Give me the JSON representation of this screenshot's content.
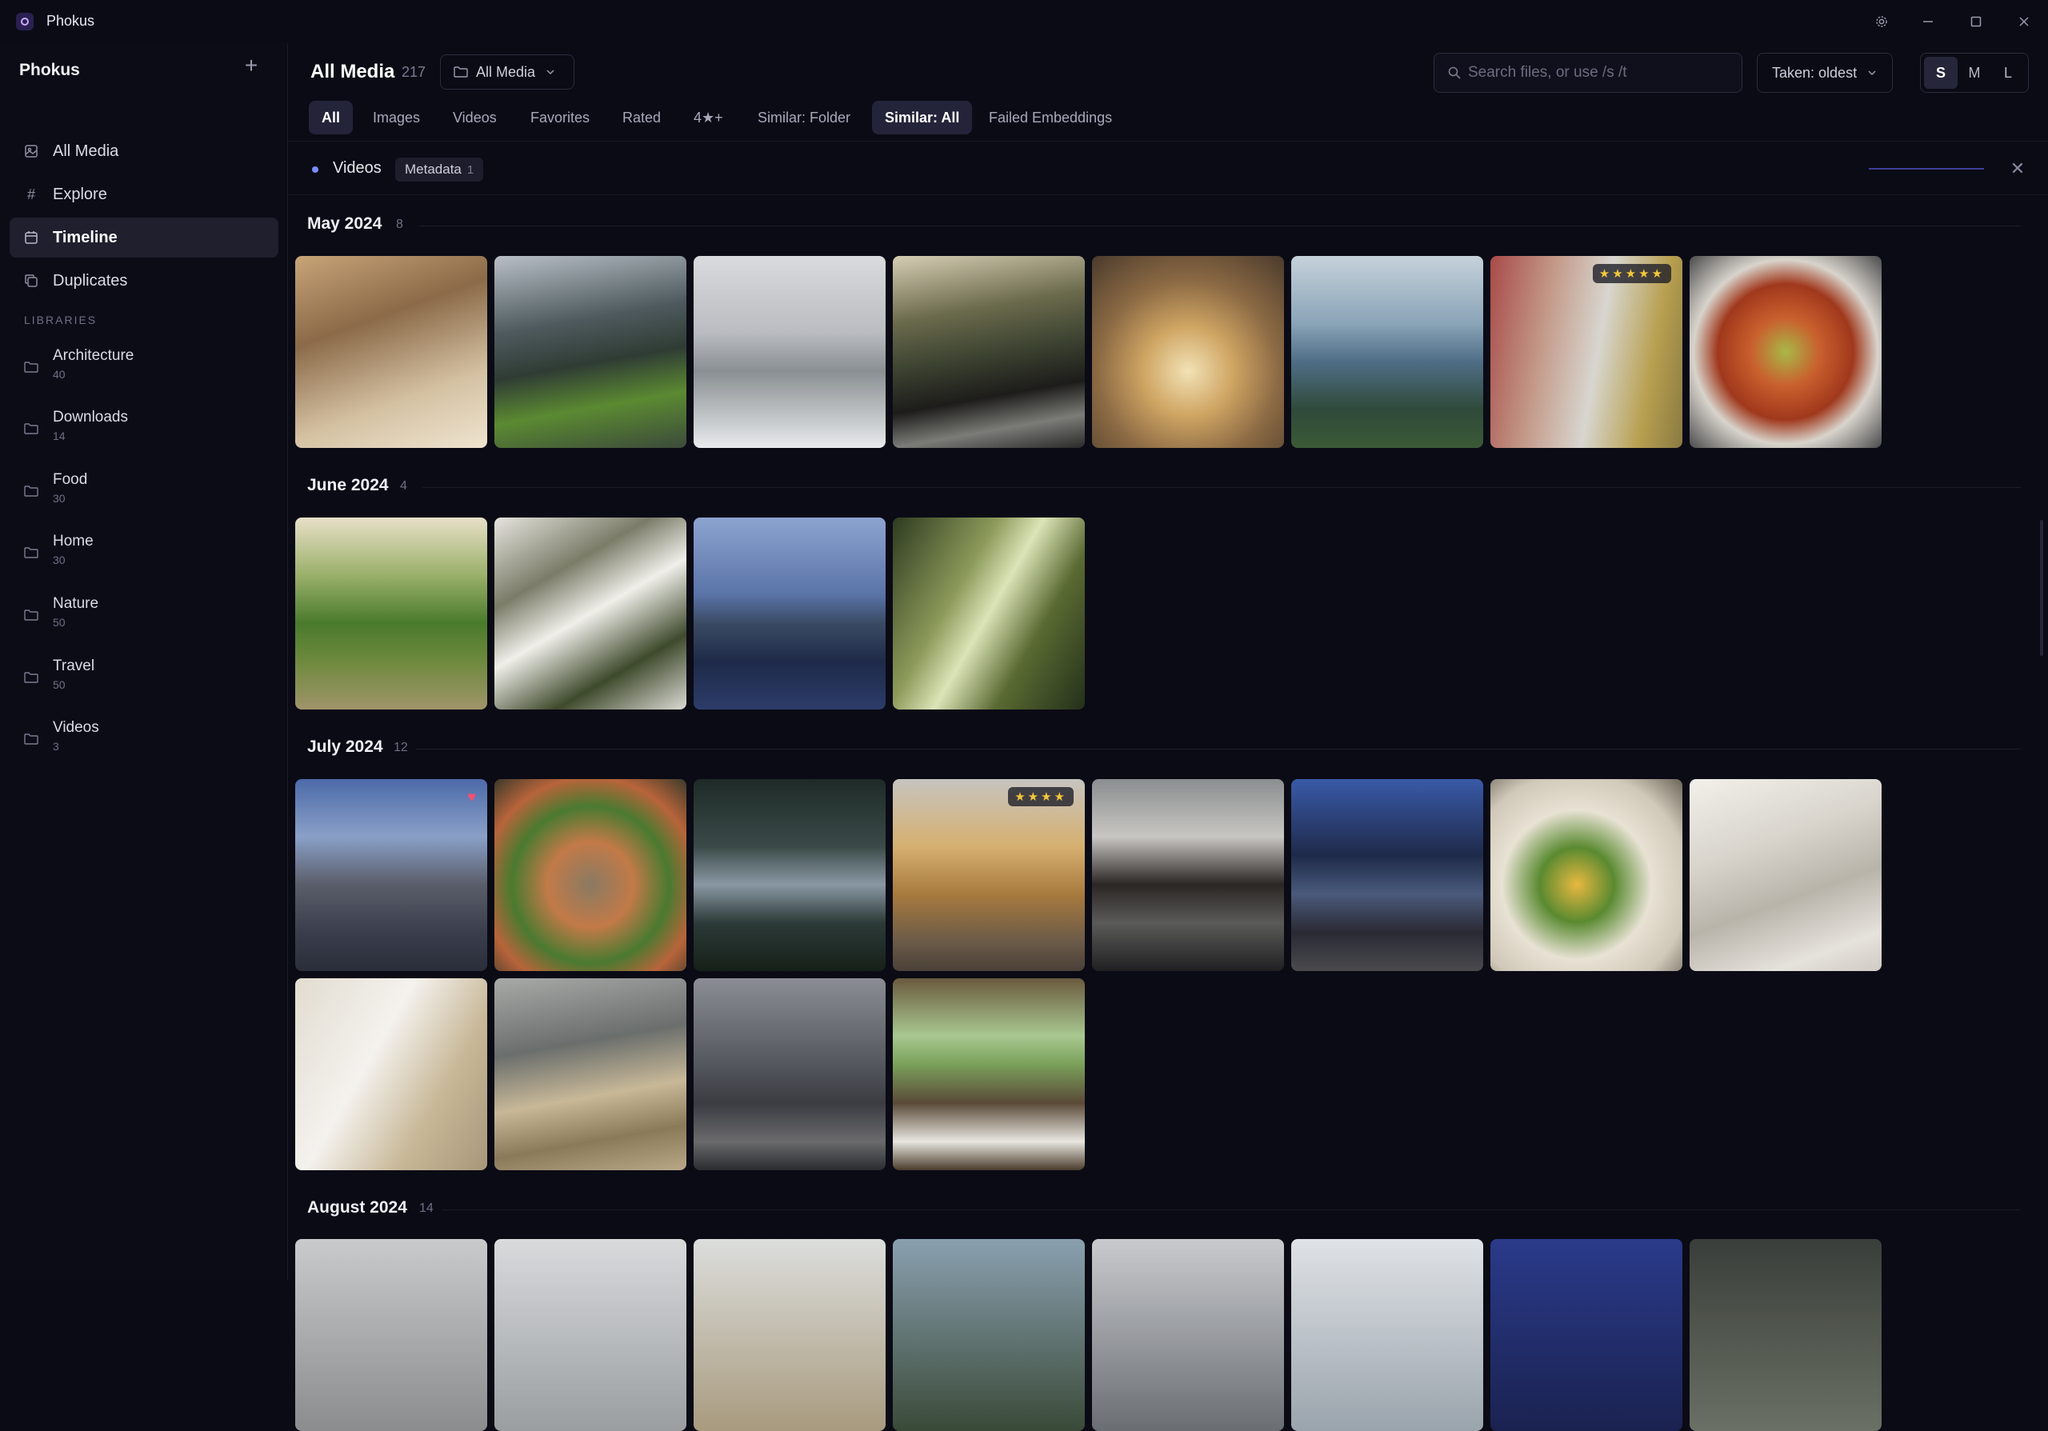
{
  "app": {
    "title": "Phokus"
  },
  "sidebar": {
    "title": "Phokus",
    "nav": [
      {
        "label": "All Media",
        "icon": "image-icon"
      },
      {
        "label": "Explore",
        "icon": "hash-icon"
      },
      {
        "label": "Timeline",
        "icon": "calendar-icon",
        "active": true
      },
      {
        "label": "Duplicates",
        "icon": "copy-icon"
      }
    ],
    "libraries_label": "LIBRARIES",
    "libraries": [
      {
        "name": "Architecture",
        "count": "40"
      },
      {
        "name": "Downloads",
        "count": "14"
      },
      {
        "name": "Food",
        "count": "30"
      },
      {
        "name": "Home",
        "count": "30"
      },
      {
        "name": "Nature",
        "count": "50"
      },
      {
        "name": "Travel",
        "count": "50"
      },
      {
        "name": "Videos",
        "count": "3"
      }
    ]
  },
  "header": {
    "title": "All Media",
    "count": "217",
    "folder_filter": "All Media",
    "search_placeholder": "Search files, or use /s /t",
    "sort": "Taken: oldest",
    "sizes": [
      "S",
      "M",
      "L"
    ],
    "active_size": "S"
  },
  "tabs": [
    "All",
    "Images",
    "Videos",
    "Favorites",
    "Rated",
    "4★+",
    "Similar: Folder",
    "Similar: All",
    "Failed Embeddings"
  ],
  "active_tabs": [
    "All",
    "Similar: All"
  ],
  "filter": {
    "title": "Videos",
    "chip": "Metadata",
    "chip_count": "1"
  },
  "sections": [
    {
      "title": "May 2024",
      "count": "8"
    },
    {
      "title": "June 2024",
      "count": "4"
    },
    {
      "title": "July 2024",
      "count": "12"
    },
    {
      "title": "August 2024",
      "count": "14"
    }
  ],
  "badges": {
    "five_stars": "★★★★★",
    "four_stars": "★★★★",
    "heart": "♥"
  },
  "colors": {
    "accent": "#7a8cff",
    "star": "#f3c63c",
    "heart": "#ff4d6d",
    "background": "#0b0b16"
  }
}
